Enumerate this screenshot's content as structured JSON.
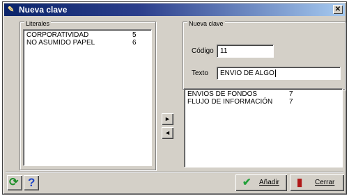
{
  "window": {
    "title": "Nueva clave"
  },
  "literales": {
    "label": "Literales",
    "items": [
      {
        "text": "CORPORATIVIDAD",
        "count": "5"
      },
      {
        "text": "NO ASUMIDO PAPEL",
        "count": "6"
      }
    ]
  },
  "nueva_clave": {
    "label": "Nueva clave",
    "codigo_label": "Código",
    "codigo_value": "11",
    "texto_label": "Texto",
    "texto_value": "ENVIO DE ALGO"
  },
  "claves_list": {
    "items": [
      {
        "text": "ENVIOS DE FONDOS",
        "count": "7"
      },
      {
        "text": "FLUJO DE INFORMACIÓN",
        "count": "7"
      }
    ]
  },
  "arrows": {
    "move_right": "►",
    "move_left": "◄"
  },
  "footer": {
    "add_label": "Añadir",
    "close_label": "Cerrar",
    "help_glyph": "?"
  }
}
